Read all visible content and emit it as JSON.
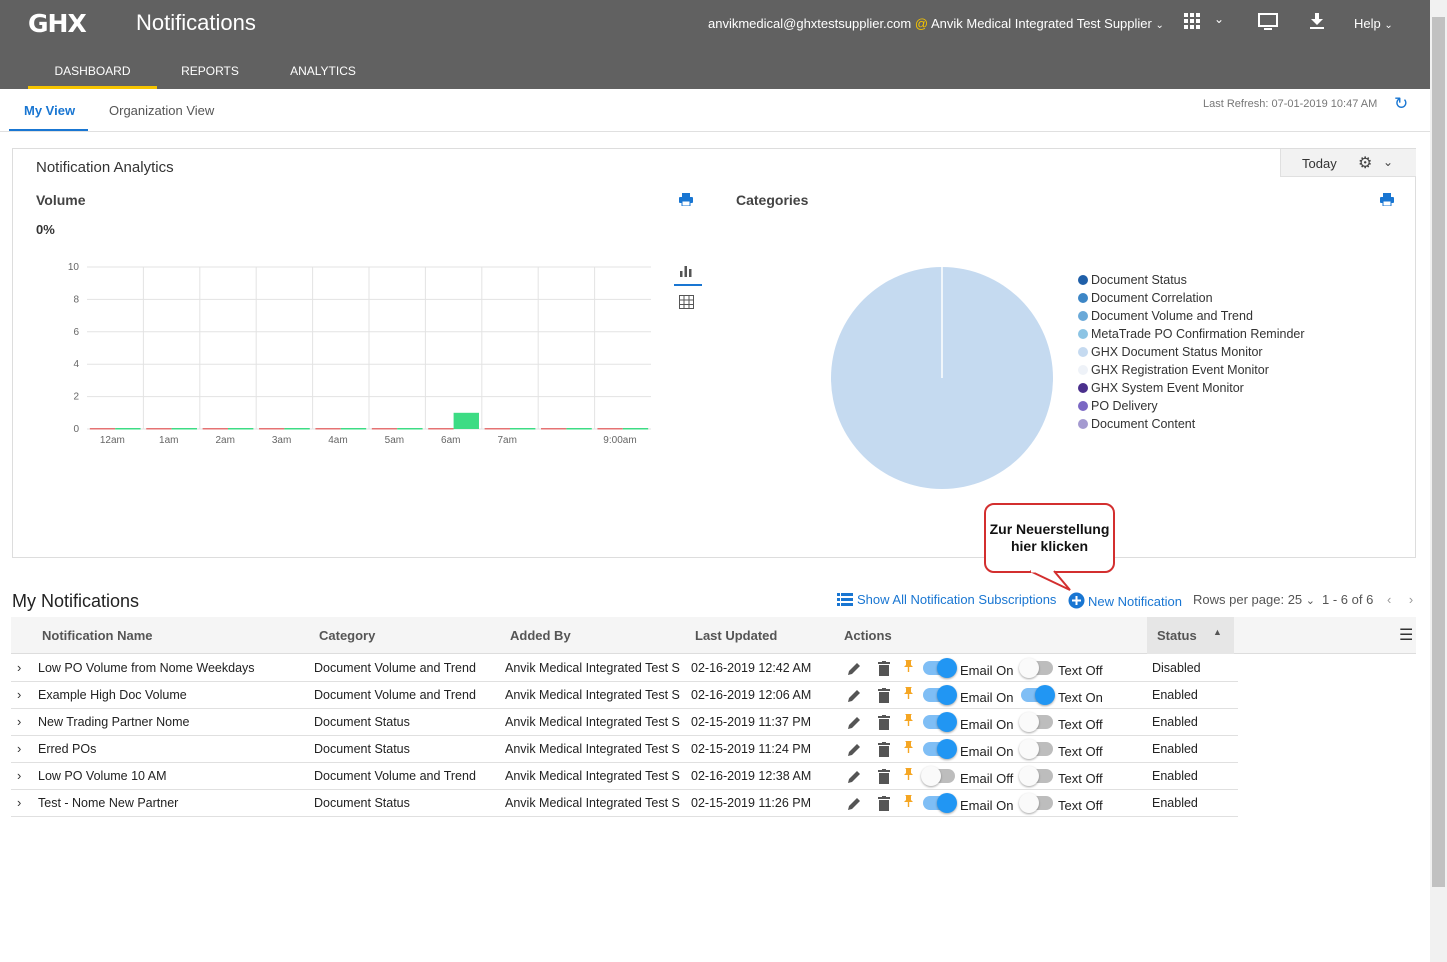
{
  "header": {
    "logo_text": "GHX",
    "app_title": "Notifications",
    "account_email": "anvikmedical@ghxtestsupplier.com",
    "account_at": "@",
    "account_org": "Anvik Medical Integrated Test Supplier",
    "help_label": "Help",
    "nav_tabs": [
      {
        "label": "DASHBOARD",
        "active": true
      },
      {
        "label": "REPORTS",
        "active": false
      },
      {
        "label": "ANALYTICS",
        "active": false
      }
    ],
    "accent_color": "#f5c400"
  },
  "subtabs": [
    {
      "label": "My View",
      "active": true
    },
    {
      "label": "Organization View",
      "active": false
    }
  ],
  "last_refresh": "Last Refresh: 07-01-2019 10:47 AM",
  "analytics": {
    "title": "Notification Analytics",
    "period": "Today",
    "volume_title": "Volume",
    "volume_percent": "0%",
    "categories_title": "Categories",
    "legend": [
      {
        "label": "Document Status",
        "color": "#1f5fa8"
      },
      {
        "label": "Document Correlation",
        "color": "#3d86c6"
      },
      {
        "label": "Document Volume and Trend",
        "color": "#6aa9d8"
      },
      {
        "label": "MetaTrade PO Confirmation Reminder",
        "color": "#8cc4e4"
      },
      {
        "label": "GHX Document Status Monitor",
        "color": "#c5daf0"
      },
      {
        "label": "GHX Registration Event Monitor",
        "color": "#eef2f8"
      },
      {
        "label": "GHX System Event Monitor",
        "color": "#4a2f8c"
      },
      {
        "label": "PO Delivery",
        "color": "#7b68c4"
      },
      {
        "label": "Document Content",
        "color": "#a49ad0"
      }
    ]
  },
  "chart_data": [
    {
      "type": "bar",
      "title": "Volume",
      "x_tick_labels": [
        "12am",
        "1am",
        "2am",
        "3am",
        "4am",
        "5am",
        "6am",
        "7am",
        "",
        "9:00am"
      ],
      "y_ticks": [
        0,
        2,
        4,
        6,
        8,
        10
      ],
      "ylim": [
        0,
        10
      ],
      "series": [
        {
          "values": [
            0,
            0,
            0,
            0,
            0,
            0,
            0,
            0,
            0,
            0
          ],
          "color": "#e57373"
        },
        {
          "values": [
            0,
            0,
            0,
            0,
            0,
            0,
            1,
            0,
            0,
            0
          ],
          "color": "#3ddc84"
        }
      ],
      "grid": true
    },
    {
      "type": "pie",
      "title": "Categories",
      "slices": [
        {
          "label": "GHX Document Status Monitor",
          "value": 100,
          "color": "#c5daf0"
        }
      ]
    }
  ],
  "callout": {
    "line1": "Zur Neuerstellung",
    "line2": "hier klicken",
    "border_color": "#d32f2f"
  },
  "notifications": {
    "title": "My Notifications",
    "show_all_label": "Show All Notification Subscriptions",
    "new_label": "New Notification",
    "rows_per_page_label": "Rows per page:",
    "rows_per_page_value": "25",
    "page_range": "1 - 6 of 6",
    "columns": [
      "Notification Name",
      "Category",
      "Added By",
      "Last Updated",
      "Actions",
      "Status"
    ],
    "rows": [
      {
        "name": "Low PO Volume from Nome Weekdays",
        "category": "Document Volume and Trend",
        "added_by": "Anvik Medical Integrated Test S...",
        "updated": "02-16-2019 12:42 AM",
        "email": "Email On",
        "email_on": true,
        "text": "Text Off",
        "text_on": false,
        "status": "Disabled"
      },
      {
        "name": "Example High Doc Volume",
        "category": "Document Volume and Trend",
        "added_by": "Anvik Medical Integrated Test S...",
        "updated": "02-16-2019 12:06 AM",
        "email": "Email On",
        "email_on": true,
        "text": "Text On",
        "text_on": true,
        "status": "Enabled"
      },
      {
        "name": "New Trading Partner Nome",
        "category": "Document Status",
        "added_by": "Anvik Medical Integrated Test S...",
        "updated": "02-15-2019 11:37 PM",
        "email": "Email On",
        "email_on": true,
        "text": "Text Off",
        "text_on": false,
        "status": "Enabled"
      },
      {
        "name": "Erred POs",
        "category": "Document Status",
        "added_by": "Anvik Medical Integrated Test S...",
        "updated": "02-15-2019 11:24 PM",
        "email": "Email On",
        "email_on": true,
        "text": "Text Off",
        "text_on": false,
        "status": "Enabled"
      },
      {
        "name": "Low PO Volume 10 AM",
        "category": "Document Volume and Trend",
        "added_by": "Anvik Medical Integrated Test S...",
        "updated": "02-16-2019 12:38 AM",
        "email": "Email Off",
        "email_on": false,
        "text": "Text Off",
        "text_on": false,
        "status": "Enabled"
      },
      {
        "name": "Test - Nome New Partner",
        "category": "Document Status",
        "added_by": "Anvik Medical Integrated Test S...",
        "updated": "02-15-2019 11:26 PM",
        "email": "Email On",
        "email_on": true,
        "text": "Text Off",
        "text_on": false,
        "status": "Enabled"
      }
    ]
  }
}
